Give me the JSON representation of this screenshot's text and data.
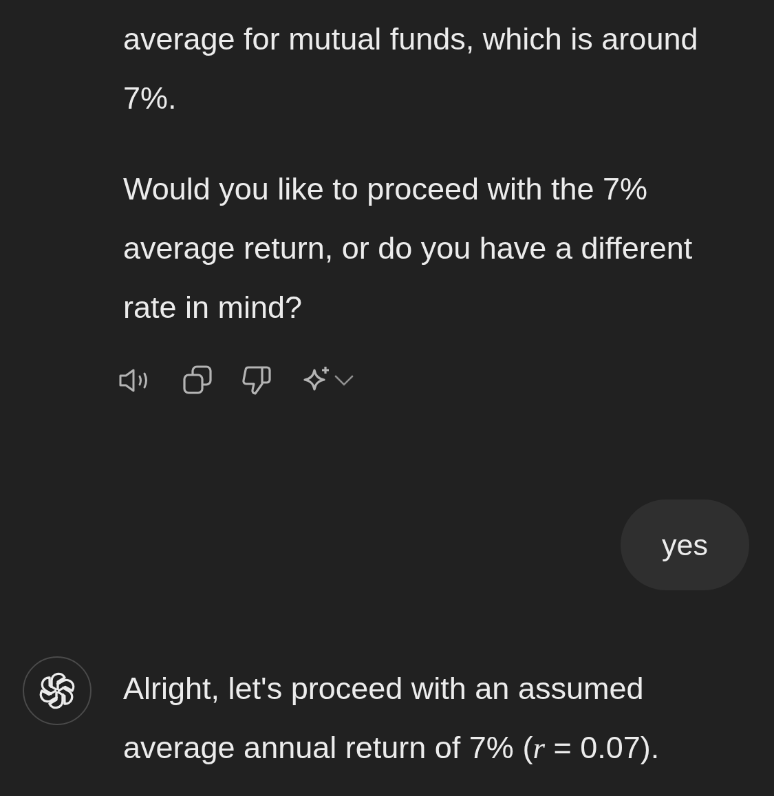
{
  "messages": [
    {
      "kind": "assistant",
      "actions": true,
      "paragraphs": [
        "average for mutual funds, which is around 7%.",
        "Would you like to proceed with the 7% average return, or do you have a different rate in mind?"
      ]
    },
    {
      "kind": "user",
      "text": "yes"
    },
    {
      "kind": "assistant",
      "avatar": true,
      "paragraphs": [
        "Alright, let's proceed with an assumed average annual return of 7% (*r* = 0.07)."
      ]
    }
  ]
}
